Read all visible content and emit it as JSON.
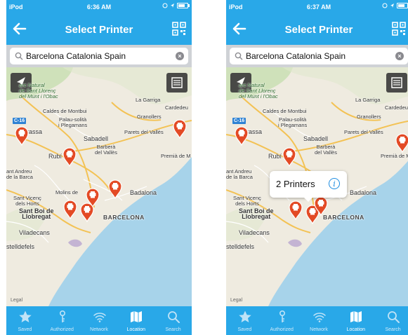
{
  "colors": {
    "accent": "#29a8e8",
    "pin": "#e34a25",
    "water": "#a7d3ea"
  },
  "screens": [
    {
      "status": {
        "carrier": "iPod",
        "time": "6:36 AM"
      },
      "nav": {
        "title": "Select Printer"
      },
      "search": {
        "value": "Barcelona Catalonia Spain"
      }
    },
    {
      "status": {
        "carrier": "iPod",
        "time": "6:37 AM"
      },
      "nav": {
        "title": "Select Printer"
      },
      "search": {
        "value": "Barcelona Catalonia Spain"
      },
      "callout": {
        "text": "2 Printers",
        "icon": "info-icon"
      }
    }
  ],
  "map_labels": {
    "park": "arc Natural\nde Sant Llorenç\ndel Munt i l'Obac",
    "la_garriga": "La Garriga",
    "cardedeu": "Cardedeu",
    "caldes": "Caldes de Montbui",
    "palau": "Palau-solità\ni Plegamans",
    "granollers": "Granollers",
    "parets": "Parets del Vallès",
    "terrassa": "rrassa",
    "sabadell": "Sabadell",
    "barbera": "Barberà\ndel Vallès",
    "rubi": "Rubí",
    "premia": "Premià de M",
    "sant_andreu": "ant Andreu\nde la Barca",
    "molins": "Molins de",
    "sant_vicenc": "Sant Vicenç\ndels Horts",
    "badalona": "Badalona",
    "sant_boi": "Sant Boi de\nLlobregat",
    "barcelona": "BARCELONA",
    "viladecans": "Viladecans",
    "castelldefels": "stelldefels",
    "road": "C-16",
    "legal": "Legal"
  },
  "tabs": [
    {
      "label": "Saved",
      "icon": "star-icon"
    },
    {
      "label": "Authorized",
      "icon": "key-icon"
    },
    {
      "label": "Network",
      "icon": "wifi-icon"
    },
    {
      "label": "Location",
      "icon": "map-icon"
    },
    {
      "label": "Search",
      "icon": "search-icon"
    }
  ],
  "active_tab": "Location"
}
